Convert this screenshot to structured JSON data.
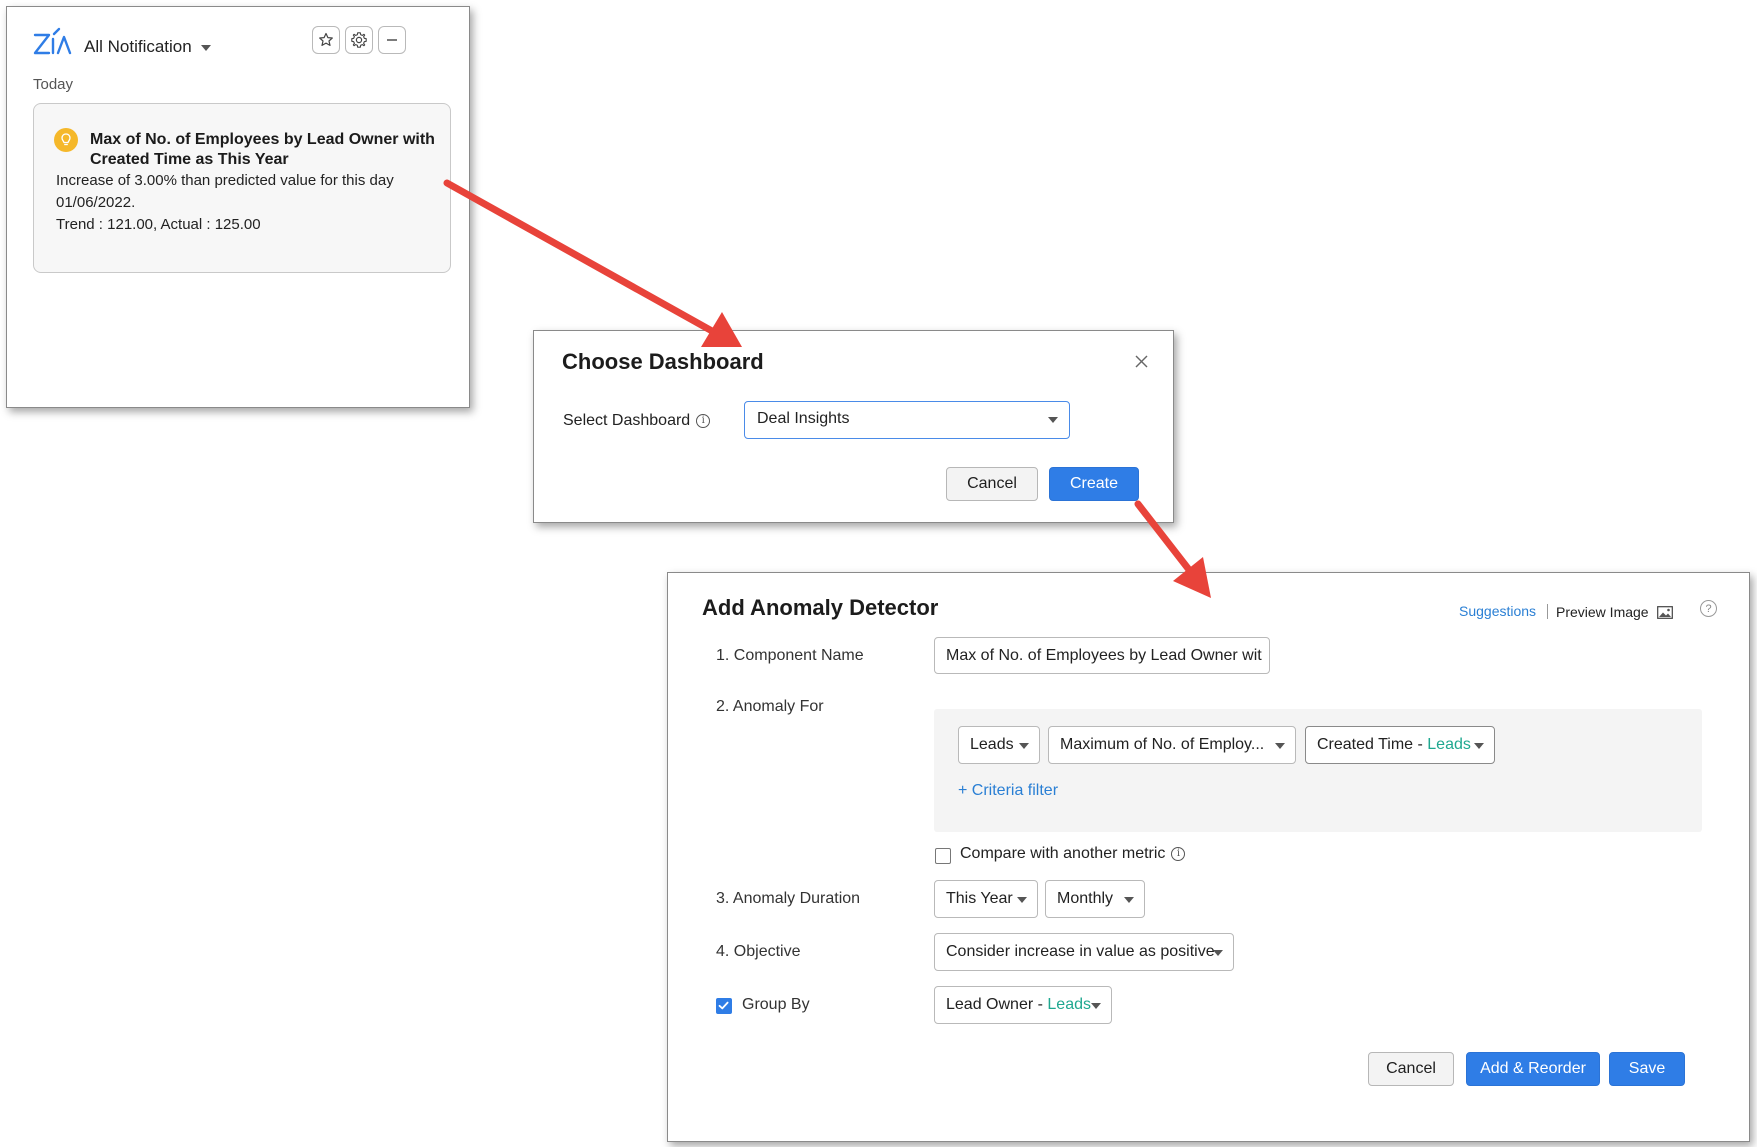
{
  "notification": {
    "title": "All Notification",
    "section": "Today",
    "card": {
      "title": "Max of No. of Employees by Lead Owner with Created Time as This Year",
      "line1": "Increase of 3.00% than predicted value for this day",
      "line2": "01/06/2022.",
      "line3": "Trend : 121.00, Actual : 125.00"
    },
    "icons": [
      "zia-logo-icon",
      "star-icon",
      "gear-icon",
      "minimize-icon",
      "bulb-icon"
    ]
  },
  "choose_dashboard": {
    "title": "Choose Dashboard",
    "select_label": "Select Dashboard",
    "selected": "Deal Insights",
    "cancel": "Cancel",
    "create": "Create"
  },
  "anomaly": {
    "title": "Add Anomaly Detector",
    "suggestions": "Suggestions",
    "preview_image": "Preview Image",
    "help": "?",
    "component_name_label": "1. Component Name",
    "component_name_value": "Max of No. of Employees by Lead Owner wit",
    "anomaly_for_label": "2. Anomaly For",
    "module": "Leads",
    "measure": "Maximum of No. of Employ...",
    "time_field": "Created Time - ",
    "time_module": "Leads",
    "criteria": "+ Criteria filter",
    "compare": "Compare with another metric",
    "duration_label": "3. Anomaly Duration",
    "duration": "This Year",
    "interval": "Monthly",
    "objective_label": "4. Objective",
    "objective": "Consider increase in value as positive",
    "group_by_label": "Group By",
    "group_field": "Lead Owner - ",
    "group_module": "Leads",
    "cancel": "Cancel",
    "add_reorder": "Add & Reorder",
    "save": "Save"
  },
  "colors": {
    "accent": "#2f7de6",
    "teal": "#1fa890",
    "arrow": "#e8433a",
    "bulb": "#f5b82a"
  }
}
